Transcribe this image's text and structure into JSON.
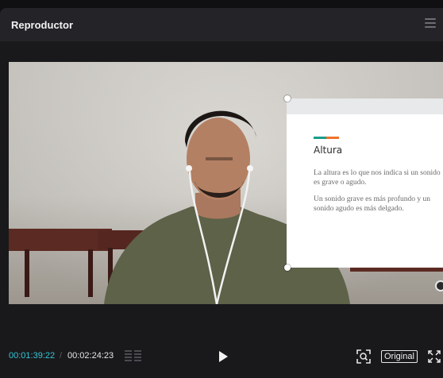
{
  "window": {
    "title": "Reproductor"
  },
  "slide": {
    "title": "Altura",
    "paragraph1": "La altura es lo que nos indica si un sonido es grave o agudo.",
    "paragraph2": "Un sonido grave es más profundo y un sonido agudo es más delgado."
  },
  "controls": {
    "current_time": "00:01:39:22",
    "separator": "/",
    "total_time": "00:02:24:23",
    "scale_label": "Original"
  },
  "colors": {
    "accent_time": "#33c7d6",
    "slide_accent_teal": "#1a9c8c",
    "slide_accent_orange": "#f0722c"
  },
  "icons": [
    "menu-icon",
    "play-icon",
    "screenshot-scan-icon",
    "fullscreen-icon",
    "waveform-icon",
    "overlay-rotate-icon"
  ]
}
